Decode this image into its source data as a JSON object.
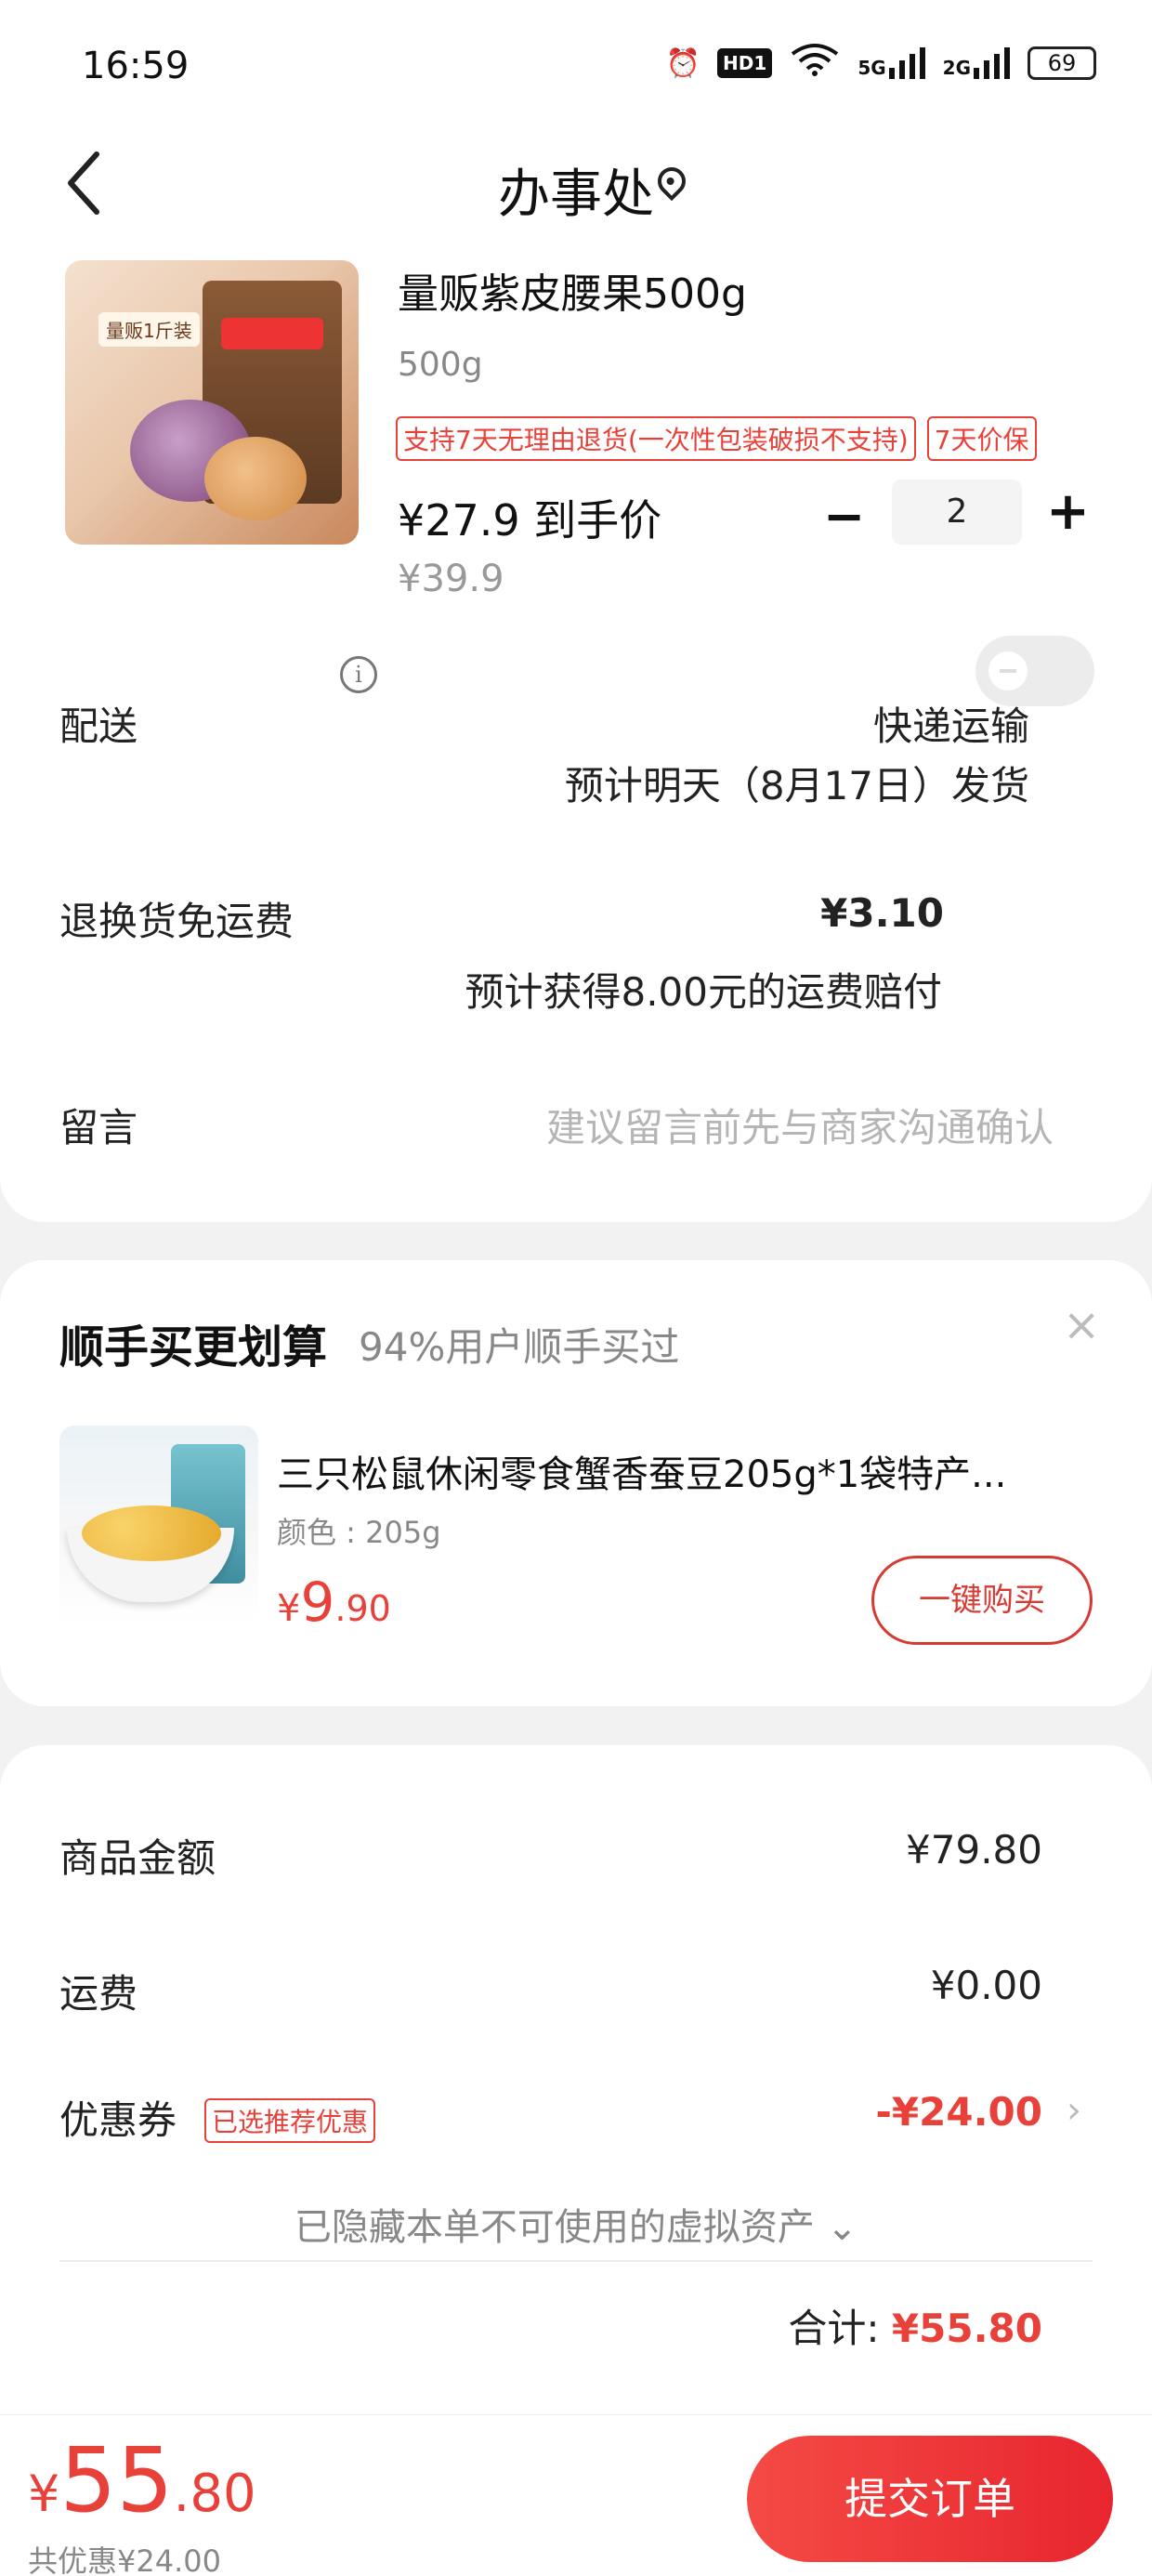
{
  "status_bar": {
    "time": "16:59",
    "network_5g": "5G",
    "network_2g": "2G",
    "hd": "HD1",
    "battery": "69"
  },
  "header": {
    "title": "办事处"
  },
  "product": {
    "name": "量贩紫皮腰果500g",
    "spec": "500g",
    "badges": [
      "支持7天无理由退货(一次性包装破损不支持)",
      "7天价保"
    ],
    "price_text": "¥27.9 到手价",
    "original_price": "¥39.9",
    "quantity": "2",
    "minus": "−",
    "plus": "+",
    "image_tag": "量贩1斤装"
  },
  "delivery": {
    "label": "配送",
    "method": "快递运输",
    "eta": "预计明天（8月17日）发货"
  },
  "return_insurance": {
    "label": "退换货免运费",
    "price": "¥3.10",
    "note": "预计获得8.00元的运费赔付",
    "enabled": false
  },
  "message": {
    "label": "留言",
    "placeholder": "建议留言前先与商家沟通确认"
  },
  "addon": {
    "title": "顺手买更划算",
    "subtitle": "94%用户顺手买过",
    "close": "×",
    "item_name": "三只松鼠休闲零食蟹香蚕豆205g*1袋特产...",
    "item_spec": "颜色 : 205g",
    "price_currency": "¥",
    "price_int": "9",
    "price_dec": ".90",
    "buy_label": "一键购买"
  },
  "summary": {
    "goods_label": "商品金额",
    "goods_value": "¥79.80",
    "shipping_label": "运费",
    "shipping_value": "¥0.00",
    "coupon_label": "优惠券",
    "coupon_tag": "已选推荐优惠",
    "coupon_value": "-¥24.00",
    "hidden_assets": "已隐藏本单不可使用的虚拟资产 ⌄",
    "total_label": "合计: ",
    "total_value": "¥55.80"
  },
  "bottom": {
    "currency": "¥",
    "price_int": "55",
    "price_dec": ".80",
    "saving": "共优惠¥24.00",
    "submit_label": "提交订单"
  },
  "colors": {
    "accent": "#e8413a",
    "background": "#f2f2f2"
  }
}
